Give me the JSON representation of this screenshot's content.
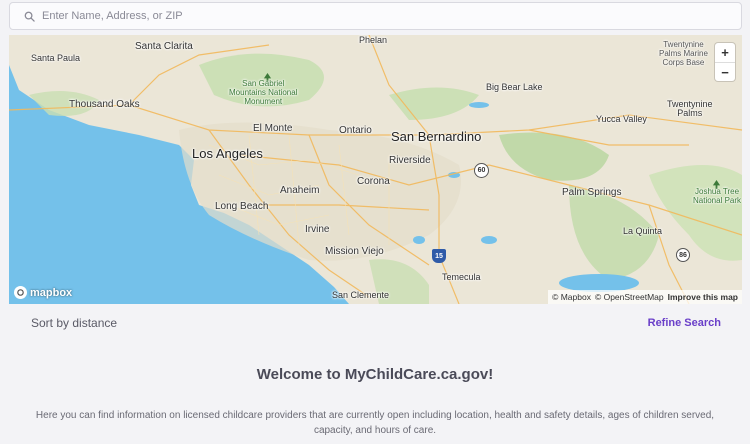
{
  "search": {
    "placeholder": "Enter Name, Address, or ZIP"
  },
  "map": {
    "labels": {
      "phelan": "Phelan",
      "santa_clarita": "Santa Clarita",
      "santa_paula": "Santa Paula",
      "twentynine_marine_1": "Twentynine",
      "twentynine_marine_2": "Palms Marine",
      "twentynine_marine_3": "Corps Base",
      "sgm_1": "San Gabriel",
      "sgm_2": "Mountains National",
      "sgm_3": "Monument",
      "big_bear": "Big Bear Lake",
      "thousand_oaks": "Thousand Oaks",
      "twentynine_palms_1": "Twentynine",
      "twentynine_palms_2": "Palms",
      "yucca_valley": "Yucca Valley",
      "el_monte": "El Monte",
      "ontario": "Ontario",
      "san_bernardino": "San Bernardino",
      "los_angeles": "Los Angeles",
      "riverside": "Riverside",
      "corona": "Corona",
      "anaheim": "Anaheim",
      "palm_springs": "Palm Springs",
      "joshua_1": "Joshua Tree",
      "joshua_2": "National Park",
      "long_beach": "Long Beach",
      "irvine": "Irvine",
      "la_quinta": "La Quinta",
      "mission_viejo": "Mission Viejo",
      "temecula": "Temecula",
      "san_clemente": "San Clemente",
      "hwy_60": "60",
      "hwy_15": "15",
      "hwy_86": "86"
    },
    "zoom_in": "+",
    "zoom_out": "−",
    "logo_text": "mapbox",
    "attribution": {
      "mapbox": "© Mapbox",
      "osm": "© OpenStreetMap",
      "improve": "Improve this map"
    }
  },
  "toolbar": {
    "sort_label": "Sort by distance",
    "refine_label": "Refine Search"
  },
  "welcome": {
    "title": "Welcome to MyChildCare.ca.gov!",
    "text": "Here you can find information on licensed childcare providers that are currently open including location, health and safety details, ages of children served, capacity, and hours of care."
  },
  "colors": {
    "accent": "#6a3fc9",
    "ocean": "#74c1ea",
    "land": "#ebe6d7",
    "park": "#b8d9a4"
  }
}
